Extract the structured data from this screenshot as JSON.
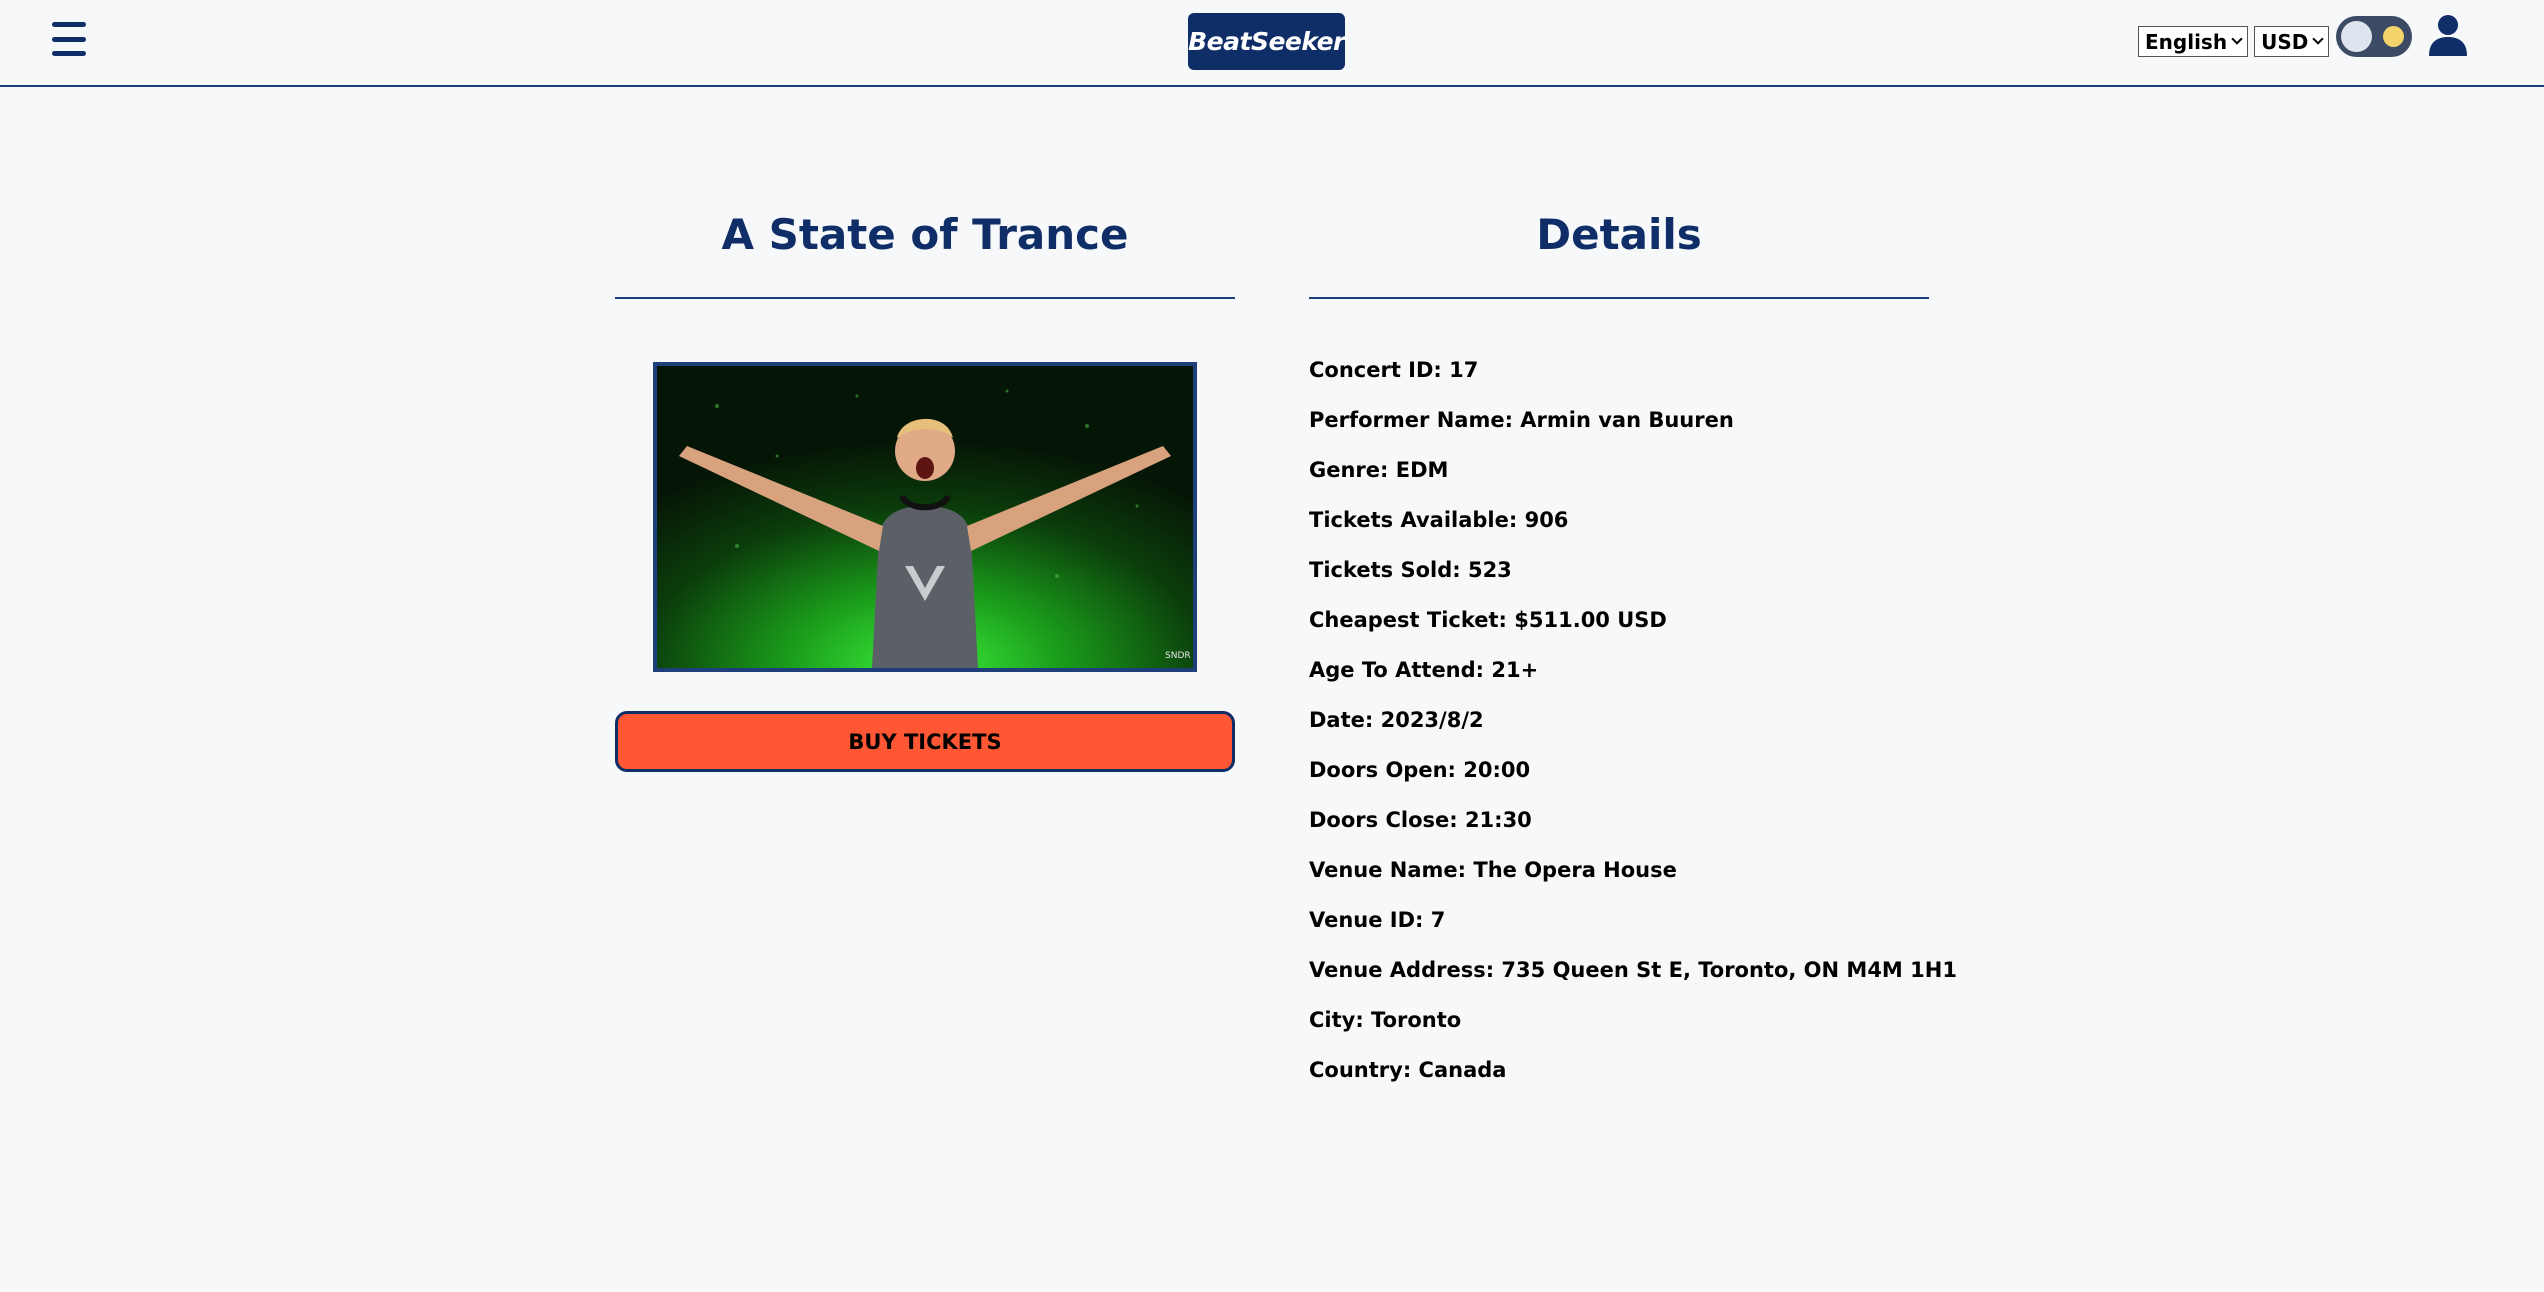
{
  "header": {
    "logo": "BeatSeeker",
    "language": "English",
    "currency": "USD"
  },
  "concert": {
    "title": "A State of Trance",
    "image_caption": "SNDR",
    "buy_label": "BUY TICKETS"
  },
  "details": {
    "title": "Details",
    "rows": [
      "Concert ID: 17",
      "Performer Name: Armin van Buuren",
      "Genre: EDM",
      "Tickets Available: 906",
      "Tickets Sold: 523",
      "Cheapest Ticket: $511.00 USD",
      "Age To Attend: 21+",
      "Date: 2023/8/2",
      "Doors Open: 20:00",
      "Doors Close: 21:30",
      "Venue Name: The Opera House",
      "Venue ID: 7",
      "Venue Address: 735 Queen St E, Toronto, ON M4M 1H1",
      "City: Toronto",
      "Country: Canada"
    ]
  },
  "colors": {
    "brand": "#0f2d66",
    "accent": "#ff5733",
    "background": "#f6f8fa"
  },
  "icons": {
    "menu": "hamburger-menu-icon",
    "theme": "theme-toggle",
    "user": "user-icon"
  }
}
